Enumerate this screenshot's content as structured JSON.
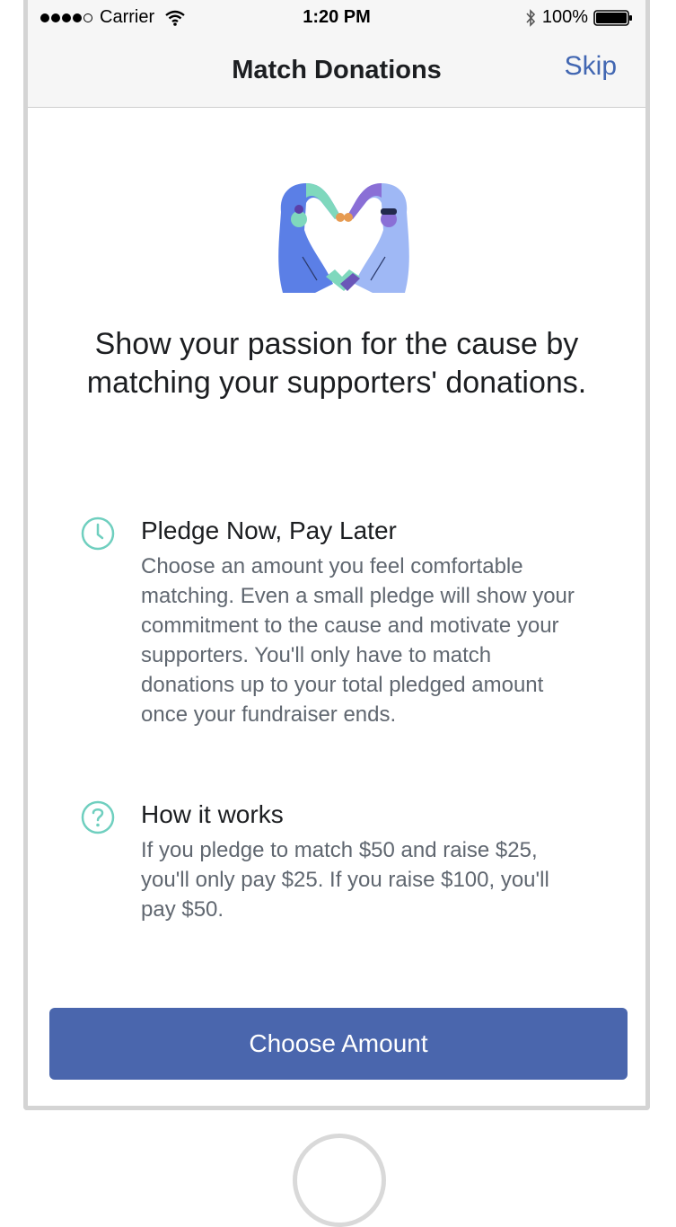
{
  "status_bar": {
    "carrier": "Carrier",
    "time": "1:20 PM",
    "battery": "100%"
  },
  "nav": {
    "title": "Match Donations",
    "skip_label": "Skip"
  },
  "headline": "Show your passion for the cause by matching your supporters' donations.",
  "features": [
    {
      "icon": "clock-icon",
      "title": "Pledge Now, Pay Later",
      "body": "Choose an amount you feel comfortable matching. Even a small pledge will show your commitment to the cause and motivate your supporters. You'll only have to match donations up to your total pledged amount once your fundraiser ends."
    },
    {
      "icon": "question-circle-icon",
      "title": "How it works",
      "body": "If you pledge to match $50 and raise $25, you'll only pay $25. If you raise $100, you'll pay $50."
    }
  ],
  "cta": {
    "label": "Choose Amount"
  },
  "colors": {
    "accent": "#4267b2",
    "button": "#4a66ad",
    "icon_teal": "#6fcfbf"
  }
}
